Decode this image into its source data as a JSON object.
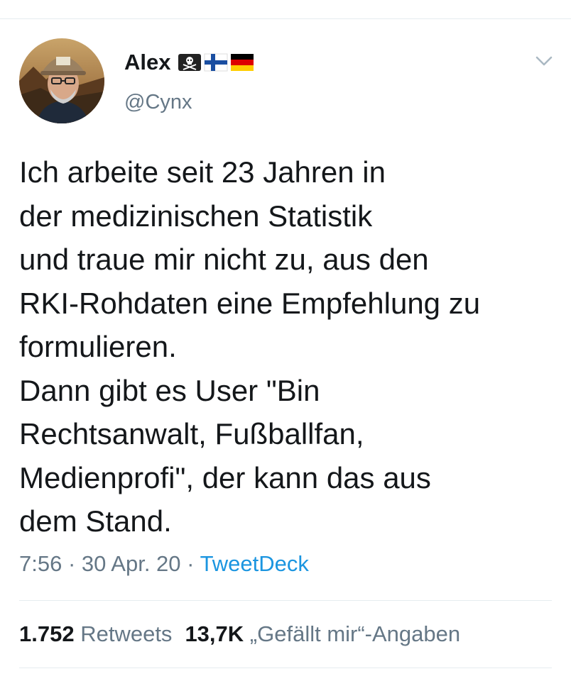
{
  "author": {
    "display_name": "Alex",
    "handle": "@Cynx",
    "emojis": [
      "pirate-flag-icon",
      "finland-flag-icon",
      "germany-flag-icon"
    ]
  },
  "tweet": {
    "text": "Ich arbeite seit 23 Jahren in\nder medizinischen Statistik\nund traue mir nicht zu, aus den\nRKI-Rohdaten eine Empfehlung zu\nformulieren.\nDann gibt es User \"Bin\nRechtsanwalt, Fußballfan,\nMedienprofi\", der kann das aus\ndem Stand.",
    "time": "7:56",
    "date": "30 Apr. 20",
    "separator": "·",
    "source": "TweetDeck"
  },
  "stats": {
    "retweets_count": "1.752",
    "retweets_label": "Retweets",
    "likes_count": "13,7K",
    "likes_label": "„Gefällt mir“-Angaben"
  },
  "colors": {
    "text": "#14171a",
    "secondary": "#657786",
    "link": "#1b95e0",
    "divider": "#e6ecf0"
  }
}
